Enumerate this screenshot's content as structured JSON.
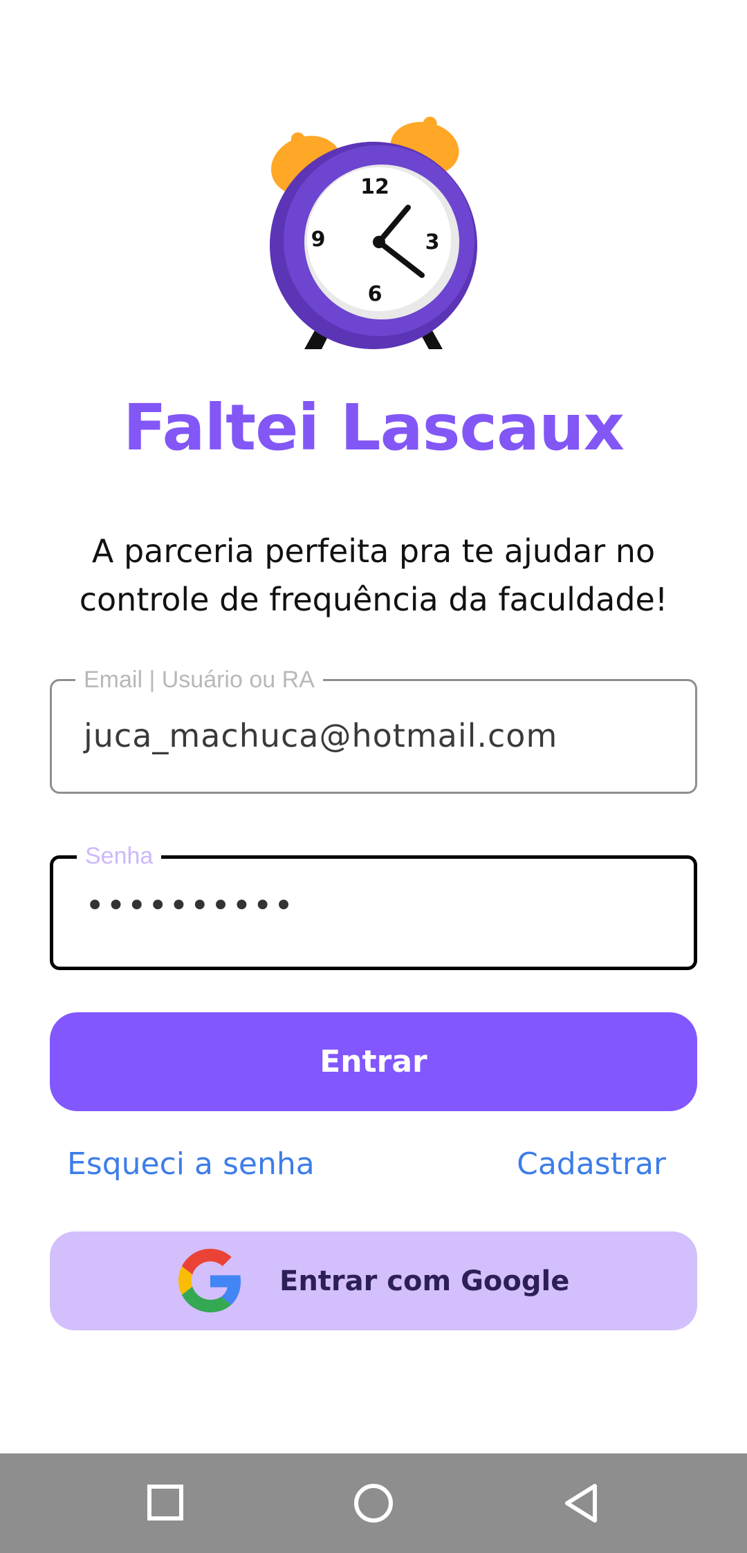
{
  "app": {
    "title": "Faltei Lascaux",
    "tagline_line1": "A parceria perfeita pra te ajudar no",
    "tagline_line2": "controle de frequência da faculdade!",
    "logo_icon": "alarm-clock-icon"
  },
  "login_form": {
    "email": {
      "label": "Email | Usuário ou RA",
      "value": "juca_machuca@hotmail.com"
    },
    "password": {
      "label": "Senha",
      "value": "••••••••••"
    },
    "submit_label": "Entrar",
    "forgot_label": "Esqueci a senha",
    "signup_label": "Cadastrar",
    "google_label": "Entrar com Google",
    "google_icon": "google-icon"
  },
  "nav_bar": {
    "recents_icon": "square-icon",
    "home_icon": "circle-icon",
    "back_icon": "triangle-back-icon"
  },
  "colors": {
    "brand_purple": "#8257fd",
    "google_button_bg": "#d2bffb",
    "link_blue": "#3d7de9",
    "nav_bar_bg": "#8e8e8e"
  }
}
